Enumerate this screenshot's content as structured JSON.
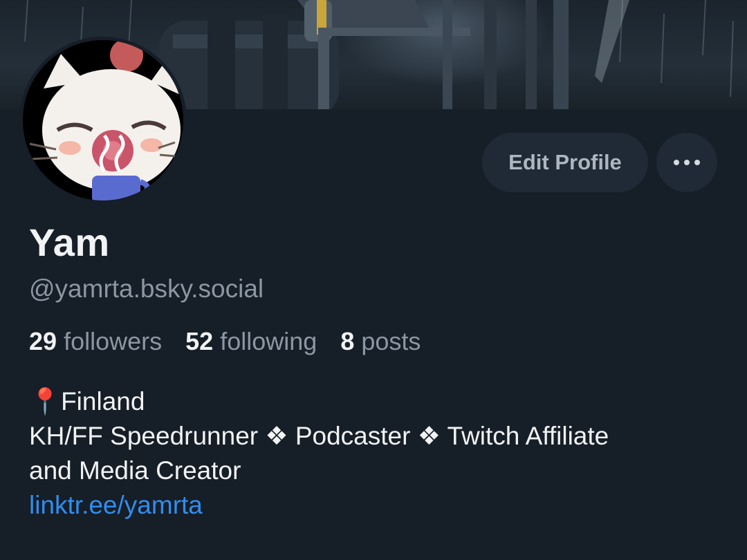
{
  "profile": {
    "display_name": "Yam",
    "handle": "@yamrta.bsky.social",
    "avatar_icon": "moogle-avatar",
    "banner": "rainy-night-banner"
  },
  "actions": {
    "edit_label": "Edit Profile",
    "more_icon": "more-dots-icon"
  },
  "stats": {
    "followers_count": "29",
    "followers_label": "followers",
    "following_count": "52",
    "following_label": "following",
    "posts_count": "8",
    "posts_label": "posts"
  },
  "bio": {
    "location_pin": "📍",
    "location": "Finland",
    "line2": "KH/FF Speedrunner ❖ Podcaster ❖ Twitch Affiliate",
    "line3": "and Media Creator",
    "link": "linktr.ee/yamrta"
  },
  "colors": {
    "background": "#161e27",
    "button_bg": "#1f2a36",
    "muted_text": "#8c97a3",
    "link": "#2f8ef0"
  }
}
